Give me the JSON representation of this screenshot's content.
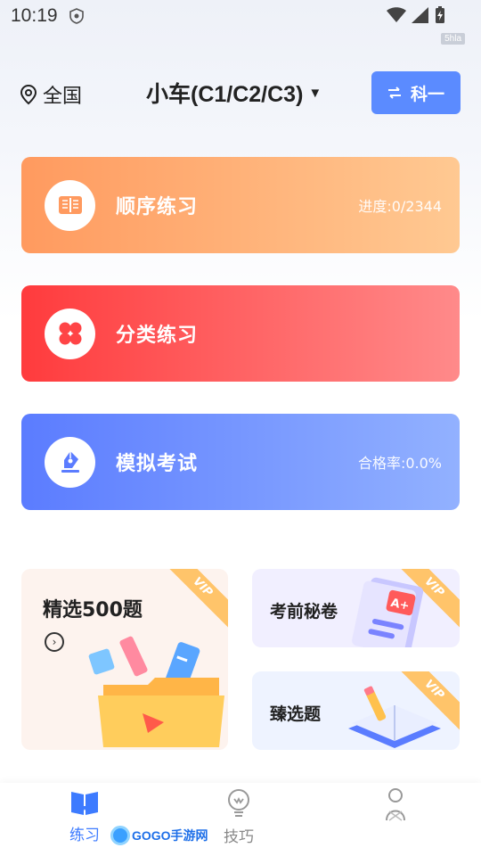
{
  "status_bar": {
    "time": "10:19",
    "watermark": "5hla"
  },
  "header": {
    "location": "全国",
    "vehicle_type": "小车(C1/C2/C3)",
    "subject_button": "科一"
  },
  "cards": {
    "order": {
      "title": "顺序练习",
      "stat": "进度:0/2344"
    },
    "category": {
      "title": "分类练习"
    },
    "mock": {
      "title": "模拟考试",
      "stat": "合格率:0.0%"
    }
  },
  "promos": {
    "select500": {
      "title": "精选500题",
      "badge": "VIP"
    },
    "secret": {
      "title": "考前秘卷",
      "badge": "VIP"
    },
    "select": {
      "title": "臻选题",
      "badge": "VIP"
    }
  },
  "bottom_nav": {
    "items": [
      {
        "label": "练习",
        "icon": "book-icon",
        "active": true
      },
      {
        "label": "技巧",
        "icon": "lightbulb-icon",
        "active": false
      },
      {
        "label": "",
        "icon": "user-icon",
        "active": false
      }
    ],
    "active_color": "#3d7bff"
  },
  "watermark_logo": "GOGO手游网",
  "colors": {
    "accent": "#5b8bff",
    "order_card": "#ff9a5f",
    "category_card": "#ff3b3d",
    "mock_card": "#5b7cff",
    "vip": "#ffc46a"
  }
}
